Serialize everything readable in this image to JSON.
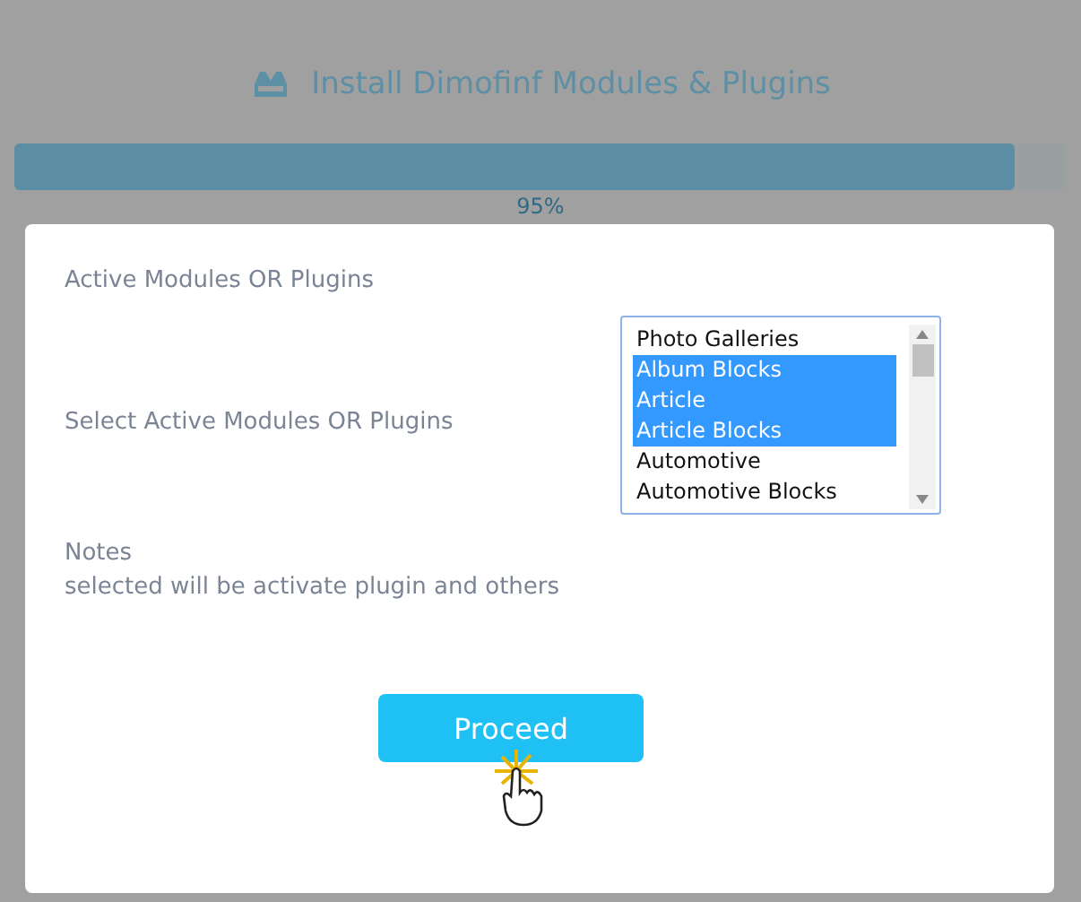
{
  "page": {
    "title": "Install Dimofinf Modules & Plugins",
    "progress": {
      "level": 0.95,
      "reading": "95%"
    }
  },
  "dialog": {
    "heading": "Active Modules OR Plugins",
    "select_label": "Select Active Modules OR Plugins",
    "options": [
      {
        "label": "Photo Galleries",
        "selected": false
      },
      {
        "label": "Album Blocks",
        "selected": true
      },
      {
        "label": "Article",
        "selected": true
      },
      {
        "label": "Article Blocks",
        "selected": true
      },
      {
        "label": "Automotive",
        "selected": false
      },
      {
        "label": "Automotive Blocks",
        "selected": false
      }
    ],
    "notes_title": "Notes",
    "notes_text": "selected will be activate plugin and others",
    "button": "Proceed"
  }
}
